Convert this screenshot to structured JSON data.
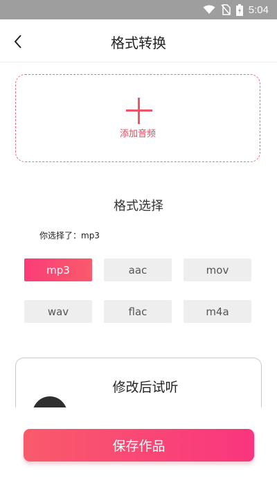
{
  "status_bar": {
    "time": "5:04",
    "icons": [
      "wifi-icon",
      "no-sim-icon",
      "battery-icon"
    ]
  },
  "app_bar": {
    "title": "格式转换",
    "back_icon": "chevron-left-icon"
  },
  "add_audio": {
    "label": "添加音频",
    "icon": "plus-icon"
  },
  "format_section": {
    "title": "格式选择",
    "selected_text": "你选择了：mp3",
    "formats": [
      {
        "label": "mp3",
        "active": true
      },
      {
        "label": "aac",
        "active": false
      },
      {
        "label": "mov",
        "active": false
      },
      {
        "label": "wav",
        "active": false
      },
      {
        "label": "flac",
        "active": false
      },
      {
        "label": "m4a",
        "active": false
      }
    ]
  },
  "preview": {
    "title": "修改后试听",
    "icon": "disc-icon"
  },
  "save_button": {
    "label": "保存作品"
  },
  "colors": {
    "accent": "#f9357e",
    "accent_start": "#f95b6b",
    "status_bar": "#9e9e9e",
    "format_bg": "#eeeeee"
  }
}
